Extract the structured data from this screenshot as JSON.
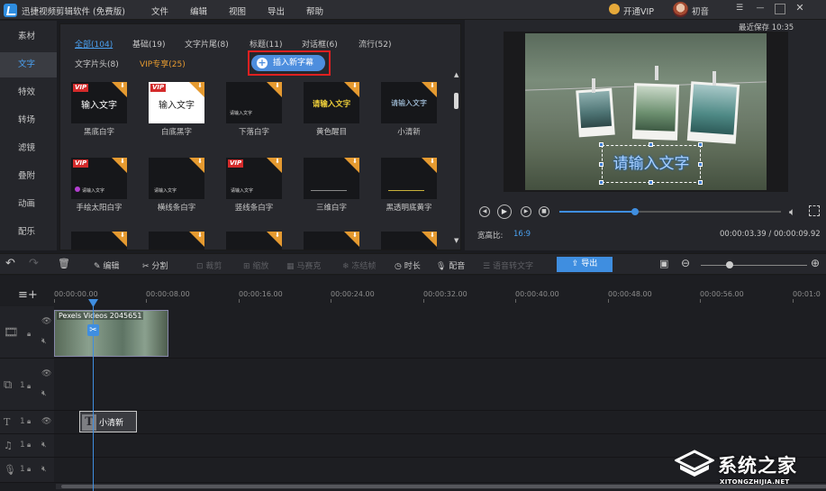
{
  "titlebar": {
    "app_title": "迅捷视频剪辑软件 (免费版)",
    "menus": [
      "文件",
      "编辑",
      "视图",
      "导出",
      "帮助"
    ],
    "vip_label": "开通VIP",
    "username": "初音"
  },
  "sidebar": {
    "items": [
      "素材",
      "文字",
      "特效",
      "转场",
      "滤镜",
      "叠附",
      "动画",
      "配乐"
    ],
    "active": "文字"
  },
  "library": {
    "tabs": [
      "全部(104)",
      "基础(19)",
      "文字片尾(8)",
      "标题(11)",
      "对话框(6)",
      "流行(52)",
      "文字片头(8)",
      "VIP专享(25)"
    ],
    "insert_button": "插入新字幕",
    "items": [
      {
        "label": "黑底白字",
        "thumb_text": "输入文字",
        "vip": "VIP"
      },
      {
        "label": "白底黑字",
        "thumb_text": "输入文字",
        "vip": "VIP"
      },
      {
        "label": "下落白字",
        "thumb_text": "请输入文字",
        "vip": ""
      },
      {
        "label": "黄色醒目",
        "thumb_text": "请输入文字",
        "vip": ""
      },
      {
        "label": "小清新",
        "thumb_text": "请输入文字",
        "vip": ""
      },
      {
        "label": "手绘太阳白字",
        "thumb_text": "请输入文字",
        "vip": "VIP"
      },
      {
        "label": "横线条白字",
        "thumb_text": "请输入文字",
        "vip": ""
      },
      {
        "label": "竖线条白字",
        "thumb_text": "请输入文字",
        "vip": "VIP"
      },
      {
        "label": "三维白字",
        "thumb_text": "",
        "vip": ""
      },
      {
        "label": "黑透明底黄字",
        "thumb_text": "",
        "vip": ""
      }
    ]
  },
  "preview": {
    "autosave": "最近保存 10:35",
    "overlay_text": "请输入文字",
    "aspect_label": "宽高比:",
    "aspect_value": "16:9",
    "time_current": "00:00:03.39",
    "time_total": "00:00:09.92",
    "time_sep": " / ",
    "progress": 0.34
  },
  "toolbar": {
    "edit": "编辑",
    "split": "分割",
    "crop": "裁剪",
    "zoom": "缩放",
    "mosaic": "马赛克",
    "freeze": "冻结帧",
    "duration": "时长",
    "dub": "配音",
    "speech": "语音转文字",
    "export": "导出"
  },
  "timeline": {
    "ticks": [
      "00:00:00.00",
      "00:00:08.00",
      "00:00:16.00",
      "00:00:24.00",
      "00:00:32.00",
      "00:00:40.00",
      "00:00:48.00",
      "00:00:56.00",
      "00:01:0"
    ],
    "video_clip_name": "Pexels Videos 2045651",
    "text_clip_label": "小清新",
    "track_num": "1"
  },
  "watermark": {
    "text": "系统之家",
    "url": "XITONGZHIJIA.NET"
  }
}
